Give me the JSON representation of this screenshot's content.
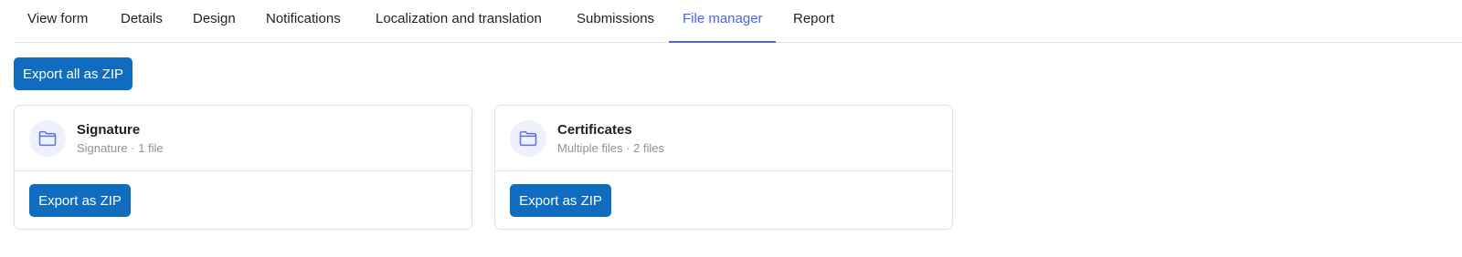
{
  "tabs": [
    {
      "label": "View form",
      "active": false
    },
    {
      "label": "Details",
      "active": false
    },
    {
      "label": "Design",
      "active": false
    },
    {
      "label": "Notifications",
      "active": false
    },
    {
      "label": "Localization and translation",
      "active": false
    },
    {
      "label": "Submissions",
      "active": false
    },
    {
      "label": "File manager",
      "active": true
    },
    {
      "label": "Report",
      "active": false
    }
  ],
  "toolbar": {
    "export_all_label": "Export all as ZIP"
  },
  "cards": [
    {
      "title": "Signature",
      "subtitle": "Signature · 1 file",
      "icon": "folder-icon",
      "export_label": "Export as ZIP"
    },
    {
      "title": "Certificates",
      "subtitle": "Multiple files · 2 files",
      "icon": "folder-icon",
      "export_label": "Export as ZIP"
    }
  ],
  "colors": {
    "primary_button": "#0f6cbf",
    "active_tab": "#4766e6",
    "folder_icon": "#5b73d9",
    "folder_circle": "#eef1fb",
    "muted_text": "#8a939c"
  }
}
